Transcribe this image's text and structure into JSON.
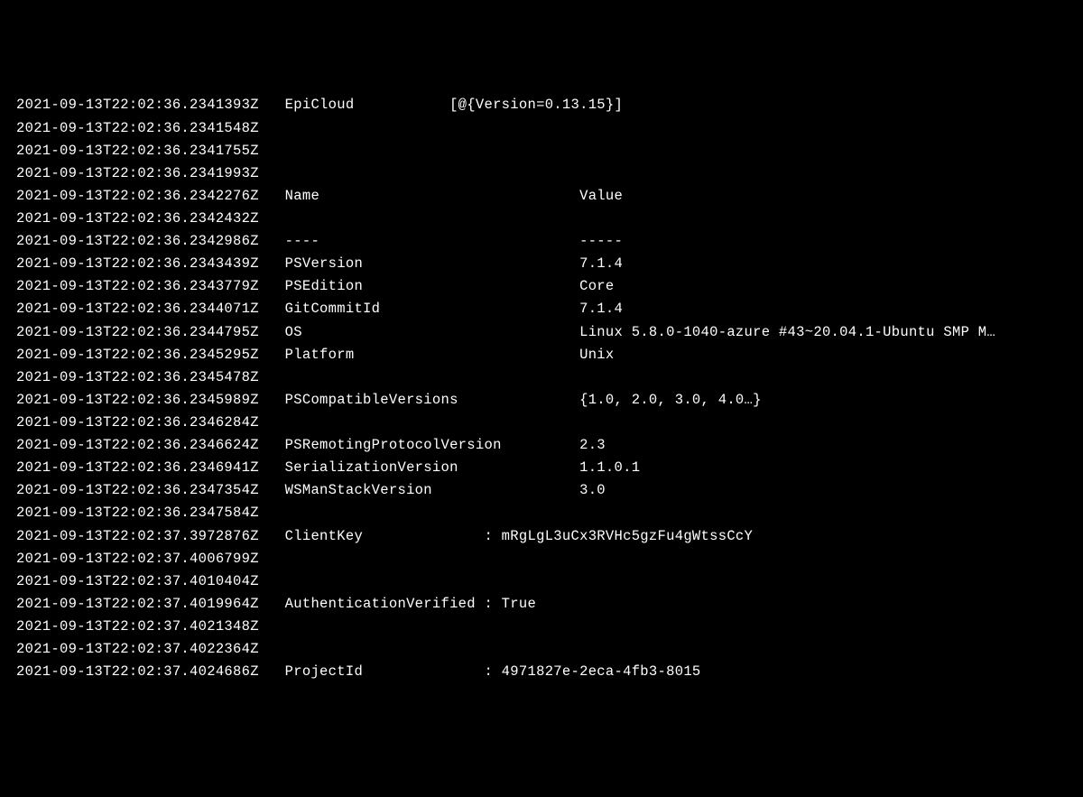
{
  "log": {
    "lines": [
      {
        "ts": "2021-09-13T22:02:36.2341393Z",
        "col1": "EpiCloud",
        "col2": "[@{Version=0.13.15}]"
      },
      {
        "ts": "2021-09-13T22:02:36.2341548Z",
        "col1": "",
        "col2": ""
      },
      {
        "ts": "2021-09-13T22:02:36.2341755Z",
        "col1": "",
        "col2": ""
      },
      {
        "ts": "2021-09-13T22:02:36.2341993Z",
        "col1": "",
        "col2": ""
      },
      {
        "ts": "2021-09-13T22:02:36.2342276Z",
        "col1": "Name",
        "col2": "Value"
      },
      {
        "ts": "2021-09-13T22:02:36.2342432Z",
        "col1": "",
        "col2": ""
      },
      {
        "ts": "2021-09-13T22:02:36.2342986Z",
        "col1": "----",
        "col2": "-----"
      },
      {
        "ts": "2021-09-13T22:02:36.2343439Z",
        "col1": "PSVersion",
        "col2": "7.1.4"
      },
      {
        "ts": "2021-09-13T22:02:36.2343779Z",
        "col1": "PSEdition",
        "col2": "Core"
      },
      {
        "ts": "2021-09-13T22:02:36.2344071Z",
        "col1": "GitCommitId",
        "col2": "7.1.4"
      },
      {
        "ts": "2021-09-13T22:02:36.2344795Z",
        "col1": "OS",
        "col2": "Linux 5.8.0-1040-azure #43~20.04.1-Ubuntu SMP M…"
      },
      {
        "ts": "2021-09-13T22:02:36.2345295Z",
        "col1": "Platform",
        "col2": "Unix"
      },
      {
        "ts": "2021-09-13T22:02:36.2345478Z",
        "col1": "",
        "col2": ""
      },
      {
        "ts": "2021-09-13T22:02:36.2345989Z",
        "col1": "PSCompatibleVersions",
        "col2": "{1.0, 2.0, 3.0, 4.0…}"
      },
      {
        "ts": "2021-09-13T22:02:36.2346284Z",
        "col1": "",
        "col2": ""
      },
      {
        "ts": "2021-09-13T22:02:36.2346624Z",
        "col1": "PSRemotingProtocolVersion",
        "col2": "2.3"
      },
      {
        "ts": "2021-09-13T22:02:36.2346941Z",
        "col1": "SerializationVersion",
        "col2": "1.1.0.1"
      },
      {
        "ts": "2021-09-13T22:02:36.2347354Z",
        "col1": "WSManStackVersion",
        "col2": "3.0"
      },
      {
        "ts": "2021-09-13T22:02:36.2347584Z",
        "col1": "",
        "col2": ""
      },
      {
        "ts": "2021-09-13T22:02:37.3972876Z",
        "kv": {
          "key": "ClientKey",
          "value": "mRgLgL3uCx3RVHc5gzFu4gWtssCcY"
        }
      },
      {
        "ts": "2021-09-13T22:02:37.4006799Z",
        "col1": "",
        "col2": ""
      },
      {
        "ts": "2021-09-13T22:02:37.4010404Z",
        "col1": "",
        "col2": ""
      },
      {
        "ts": "2021-09-13T22:02:37.4019964Z",
        "kv": {
          "key": "AuthenticationVerified",
          "value": "True"
        }
      },
      {
        "ts": "2021-09-13T22:02:37.4021348Z",
        "col1": "",
        "col2": ""
      },
      {
        "ts": "2021-09-13T22:02:37.4022364Z",
        "col1": "",
        "col2": ""
      },
      {
        "ts": "2021-09-13T22:02:37.4024686Z",
        "kv": {
          "key": "ProjectId",
          "value": "4971827e-2eca-4fb3-8015"
        }
      }
    ],
    "layout": {
      "tsWidth": 30,
      "col1Start": 31,
      "col1Width": 19,
      "col2Start": 50,
      "tableCol2Start": 65,
      "kvKeyWidth": 22
    }
  }
}
